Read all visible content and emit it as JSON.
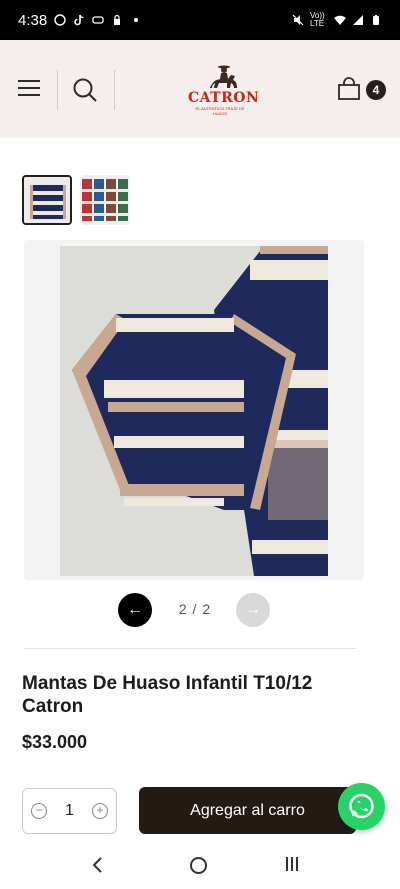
{
  "status_bar": {
    "time": "4:38",
    "network_label": "Vo)) LTE",
    "icons_left": [
      "whatsapp-icon",
      "tiktok-icon",
      "gamepad-icon",
      "lock-icon",
      "dot-icon"
    ],
    "icons_right": [
      "mute-icon",
      "wifi-icon",
      "signal-icon",
      "battery-icon"
    ]
  },
  "header": {
    "brand": "CATRON",
    "brand_tagline": "EL AUTENTICO TRAJE DE HUASO",
    "cart_count": "4",
    "accent": "#c8241c",
    "background": "#f6eeec"
  },
  "gallery": {
    "thumbnails": [
      "thumb-navy-stripes",
      "thumb-multicolor"
    ],
    "active_index": 1,
    "pager": "2 / 2",
    "prev_label": "←",
    "next_label": "→"
  },
  "product": {
    "title": "Mantas De Huaso Infantil T10/12 Catron",
    "price": "$33.000"
  },
  "purchase": {
    "quantity": "1",
    "minus": "−",
    "plus": "+",
    "add_label": "Agregar al carro"
  },
  "colors": {
    "dark": "#241b14",
    "whatsapp": "#27d366",
    "navy": "#1d2a5b",
    "cream": "#efe8dc",
    "tan": "#c9a892"
  }
}
